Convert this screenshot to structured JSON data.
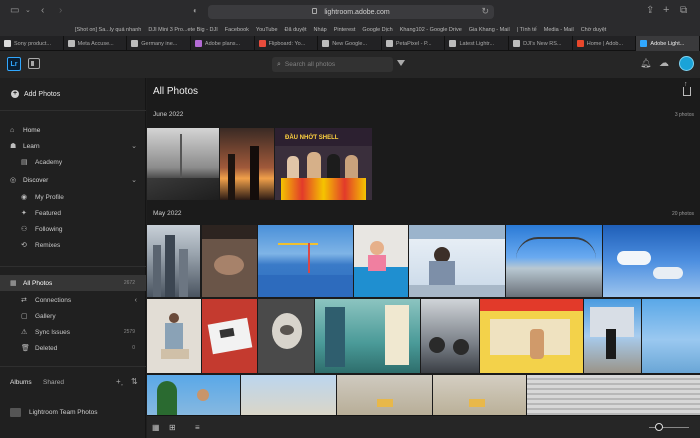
{
  "browser": {
    "url": "lightroom.adobe.com",
    "bookmarks": [
      "[Shot on] Sa...ly quá nhanh",
      "DJI Mini 3 Pro...ete Big - DJI",
      "Facebook",
      "YouTube",
      "Đã duyệt",
      "Nháp",
      "Pinterest",
      "Google Dịch",
      "Khang102 - Google Drive",
      "Gia Khang - Mail",
      "| Tình tế",
      "Media - Mail",
      "Chờ duyệt"
    ],
    "tabs": [
      {
        "title": "Sony product...",
        "active": false
      },
      {
        "title": "Meta Accuse...",
        "active": false
      },
      {
        "title": "Germany ine...",
        "active": false
      },
      {
        "title": "Adobe plans...",
        "active": false
      },
      {
        "title": "Flipboard: Yo...",
        "active": false
      },
      {
        "title": "New Google...",
        "active": false
      },
      {
        "title": "PetaPixel - P...",
        "active": false
      },
      {
        "title": "Latest Lightr...",
        "active": false
      },
      {
        "title": "DJI's New RS...",
        "active": false
      },
      {
        "title": "Home | Adob...",
        "active": false
      },
      {
        "title": "Adobe Light...",
        "active": true
      }
    ]
  },
  "app": {
    "logo": "Lr",
    "search_placeholder": "Search all photos"
  },
  "sidebar": {
    "add_photos": "Add Photos",
    "home": "Home",
    "learn": "Learn",
    "academy": "Academy",
    "discover": "Discover",
    "my_profile": "My Profile",
    "featured": "Featured",
    "following": "Following",
    "remixes": "Remixes",
    "all_photos": "All Photos",
    "all_photos_count": "2672",
    "connections": "Connections",
    "gallery": "Gallery",
    "sync_issues": "Sync Issues",
    "sync_issues_count": "2579",
    "deleted": "Deleted",
    "deleted_count": "0",
    "albums_tab": "Albums",
    "shared_tab": "Shared",
    "album_name": "Lightroom Team Photos"
  },
  "main": {
    "title": "All Photos",
    "sections": [
      {
        "label": "June 2022",
        "count": "3 photos"
      },
      {
        "label": "May 2022",
        "count": "20 photos"
      }
    ],
    "banner_text": "ĐẦU NHỚT SHELL"
  },
  "colors": {
    "accent": "#31a8ff",
    "selected_bg": "#363636"
  }
}
